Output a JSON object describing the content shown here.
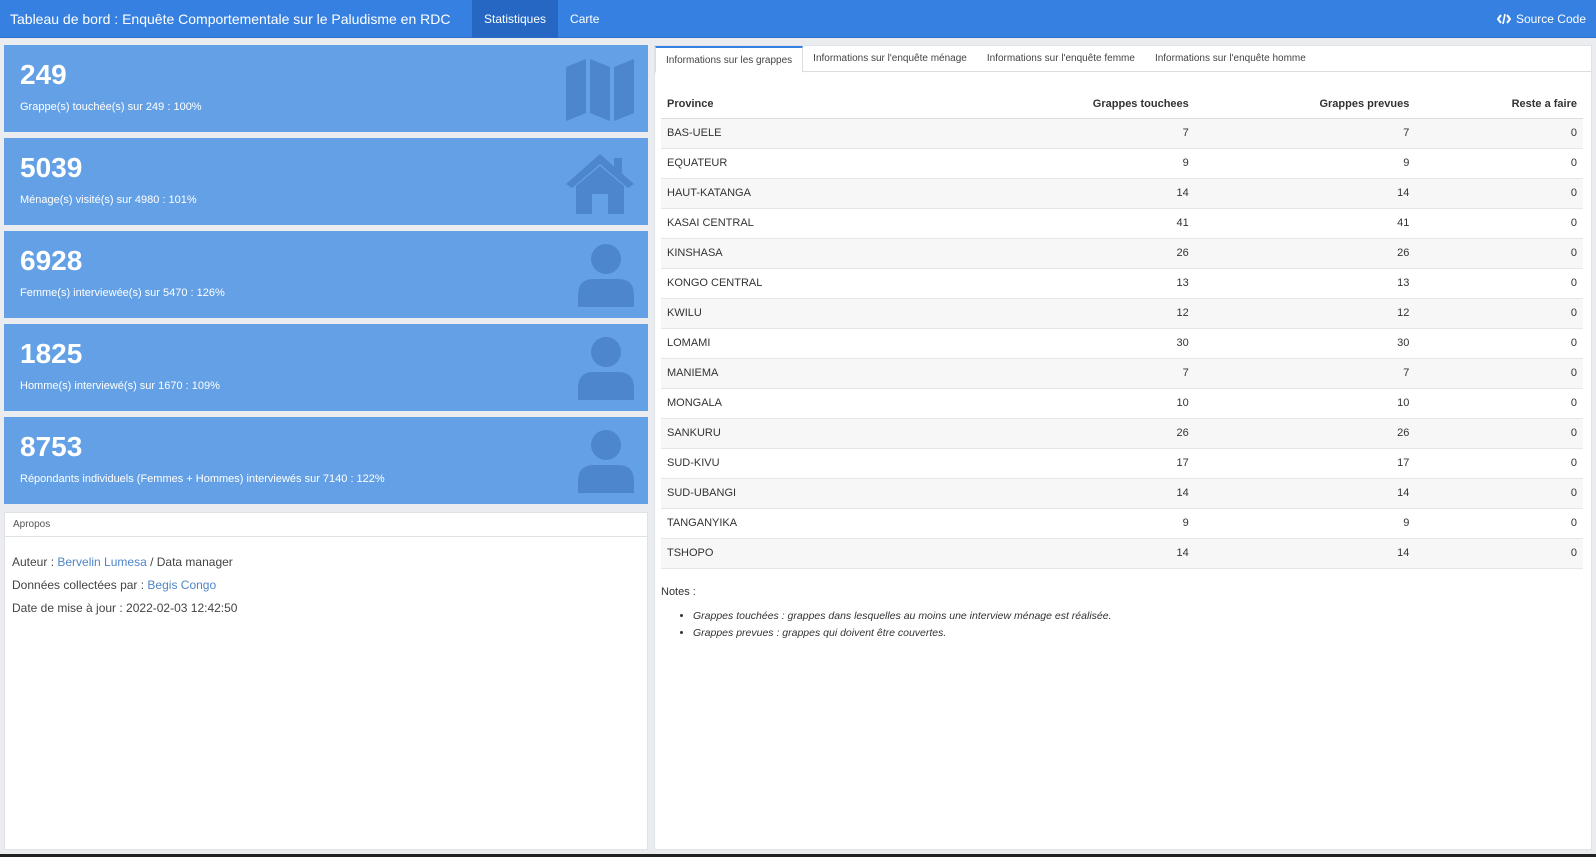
{
  "navbar": {
    "title": "Tableau de bord : Enquête Comportementale sur le Paludisme en RDC",
    "tabs": [
      "Statistiques",
      "Carte"
    ],
    "source_label": "Source Code"
  },
  "value_boxes": [
    {
      "value": "249",
      "subtitle": "Grappe(s) touchée(s) sur 249 : 100%",
      "icon": "map-icon"
    },
    {
      "value": "5039",
      "subtitle": "Ménage(s) visité(s) sur 4980 : 101%",
      "icon": "home-icon"
    },
    {
      "value": "6928",
      "subtitle": "Femme(s) interviewée(s) sur 5470 : 126%",
      "icon": "user-icon"
    },
    {
      "value": "1825",
      "subtitle": "Homme(s) interviewé(s) sur 1670 : 109%",
      "icon": "user-icon"
    },
    {
      "value": "8753",
      "subtitle": "Répondants individuels (Femmes + Hommes) interviewés sur 7140 : 122%",
      "icon": "user-icon"
    }
  ],
  "apropos": {
    "header": "Apropos",
    "author_prefix": "Auteur : ",
    "author_name": "Bervelin Lumesa",
    "author_suffix": " / Data manager",
    "collected_prefix": "Données collectées par : ",
    "collected_by": "Begis Congo",
    "updated": "Date de mise à jour : 2022-02-03 12:42:50"
  },
  "tabs": [
    "Informations sur les grappes",
    "Informations sur l'enquête ménage",
    "Informations sur l'enquête femme",
    "Informations sur l'enquête homme"
  ],
  "table": {
    "headers": [
      "Province",
      "Grappes touchees",
      "Grappes prevues",
      "Reste a faire"
    ],
    "rows": [
      [
        "BAS-UELE",
        "7",
        "7",
        "0"
      ],
      [
        "EQUATEUR",
        "9",
        "9",
        "0"
      ],
      [
        "HAUT-KATANGA",
        "14",
        "14",
        "0"
      ],
      [
        "KASAI CENTRAL",
        "41",
        "41",
        "0"
      ],
      [
        "KINSHASA",
        "26",
        "26",
        "0"
      ],
      [
        "KONGO CENTRAL",
        "13",
        "13",
        "0"
      ],
      [
        "KWILU",
        "12",
        "12",
        "0"
      ],
      [
        "LOMAMI",
        "30",
        "30",
        "0"
      ],
      [
        "MANIEMA",
        "7",
        "7",
        "0"
      ],
      [
        "MONGALA",
        "10",
        "10",
        "0"
      ],
      [
        "SANKURU",
        "26",
        "26",
        "0"
      ],
      [
        "SUD-KIVU",
        "17",
        "17",
        "0"
      ],
      [
        "SUD-UBANGI",
        "14",
        "14",
        "0"
      ],
      [
        "TANGANYIKA",
        "9",
        "9",
        "0"
      ],
      [
        "TSHOPO",
        "14",
        "14",
        "0"
      ]
    ]
  },
  "notes": {
    "title": "Notes :",
    "items": [
      "Grappes touchées : grappes dans lesquelles au moins une interview ménage est réalisée.",
      "Grappes prevues : grappes qui doivent être couvertes."
    ]
  }
}
